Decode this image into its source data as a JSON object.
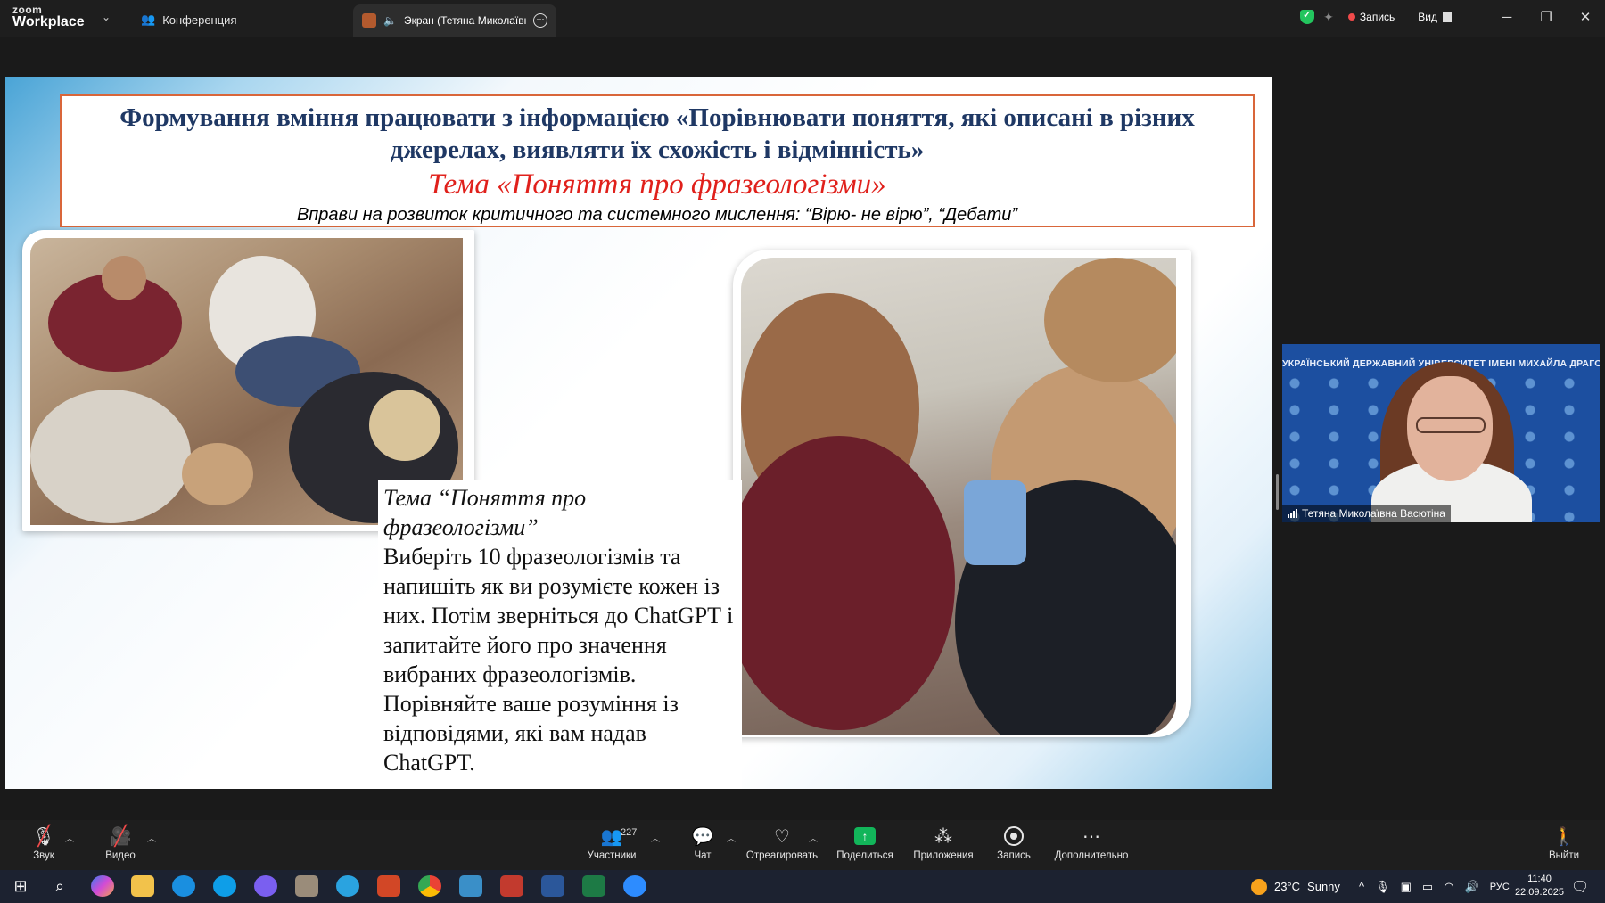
{
  "app": {
    "brand_small": "zoom",
    "brand_large": "Workplace",
    "conference_tab": "Конференция",
    "share_tab": "Экран (Тетяна Миколаївна В",
    "record_status": "Запись",
    "view_label": "Вид"
  },
  "slide": {
    "title_line1": "Формування вміння працювати з інформацією «Порівнювати поняття, які описані в різних",
    "title_line2": "джерелах, виявляти їх схожість і відмінність»",
    "topic": "Тема «Поняття про фразеологізми»",
    "subtitle": "Вправи на розвиток критичного та системного мислення:  “Вірю- не вірю”, “Дебати”",
    "textbox_topic": "Тема “Поняття про фразеологізми”",
    "textbox_body": "Виберіть 10 фразеологізмів та напишіть як ви розумієте кожен із них. Потім зверніться до ChatGPT і запитайте його про значення вибраних фразеологізмів. Порівняйте ваше розуміння із відповідями, які вам надав ChatGPT."
  },
  "participant": {
    "name": "Тетяна Миколаївна Васютіна",
    "background_text": "УКРАЇНСЬКИЙ ДЕРЖАВНИЙ УНІВЕРСИТЕТ ІМЕНІ МИХАЙЛА ДРАГОМАНОВА"
  },
  "toolbar": {
    "audio": "Звук",
    "video": "Видео",
    "participants": "Участники",
    "participants_count": "227",
    "chat": "Чат",
    "react": "Отреагировать",
    "share": "Поделиться",
    "apps": "Приложения",
    "record": "Запись",
    "more": "Дополнительно",
    "leave": "Выйти"
  },
  "taskbar": {
    "weather_temp": "23°C",
    "weather_desc": "Sunny",
    "language": "РУС",
    "time": "11:40",
    "date": "22.09.2025"
  },
  "colors": {
    "title_blue": "#1f3864",
    "topic_red": "#e0201b",
    "header_border": "#d9663a",
    "share_green": "#12b55a",
    "record_red": "#f04a4a"
  }
}
